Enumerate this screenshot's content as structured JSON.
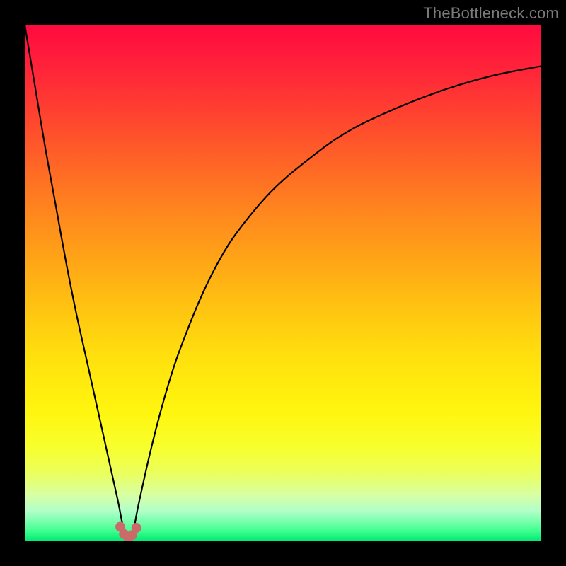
{
  "watermark": {
    "text": "TheBottleneck.com"
  },
  "chart_data": {
    "type": "line",
    "title": "",
    "xlabel": "",
    "ylabel": "",
    "xlim": [
      0,
      100
    ],
    "ylim": [
      0,
      100
    ],
    "grid": false,
    "legend": false,
    "background": "heat-gradient",
    "series": [
      {
        "name": "bottleneck-curve",
        "x": [
          0,
          2,
          4,
          6,
          8,
          10,
          12,
          14,
          16,
          18,
          19,
          20,
          21,
          22,
          24,
          26,
          28,
          30,
          34,
          38,
          42,
          48,
          55,
          62,
          70,
          80,
          90,
          100
        ],
        "values": [
          100,
          88,
          76,
          65,
          54,
          44,
          35,
          26,
          17,
          8,
          3,
          0,
          2,
          7,
          16,
          24,
          31,
          37,
          47,
          55,
          61,
          68,
          74,
          79,
          83,
          87,
          90,
          92
        ]
      }
    ],
    "markers": {
      "name": "minimum-cluster",
      "color": "#cc6a6a",
      "points": [
        {
          "x": 18.5,
          "y": 2.8
        },
        {
          "x": 19.2,
          "y": 1.4
        },
        {
          "x": 20.0,
          "y": 0.8
        },
        {
          "x": 20.8,
          "y": 1.2
        },
        {
          "x": 21.6,
          "y": 2.6
        }
      ]
    }
  }
}
